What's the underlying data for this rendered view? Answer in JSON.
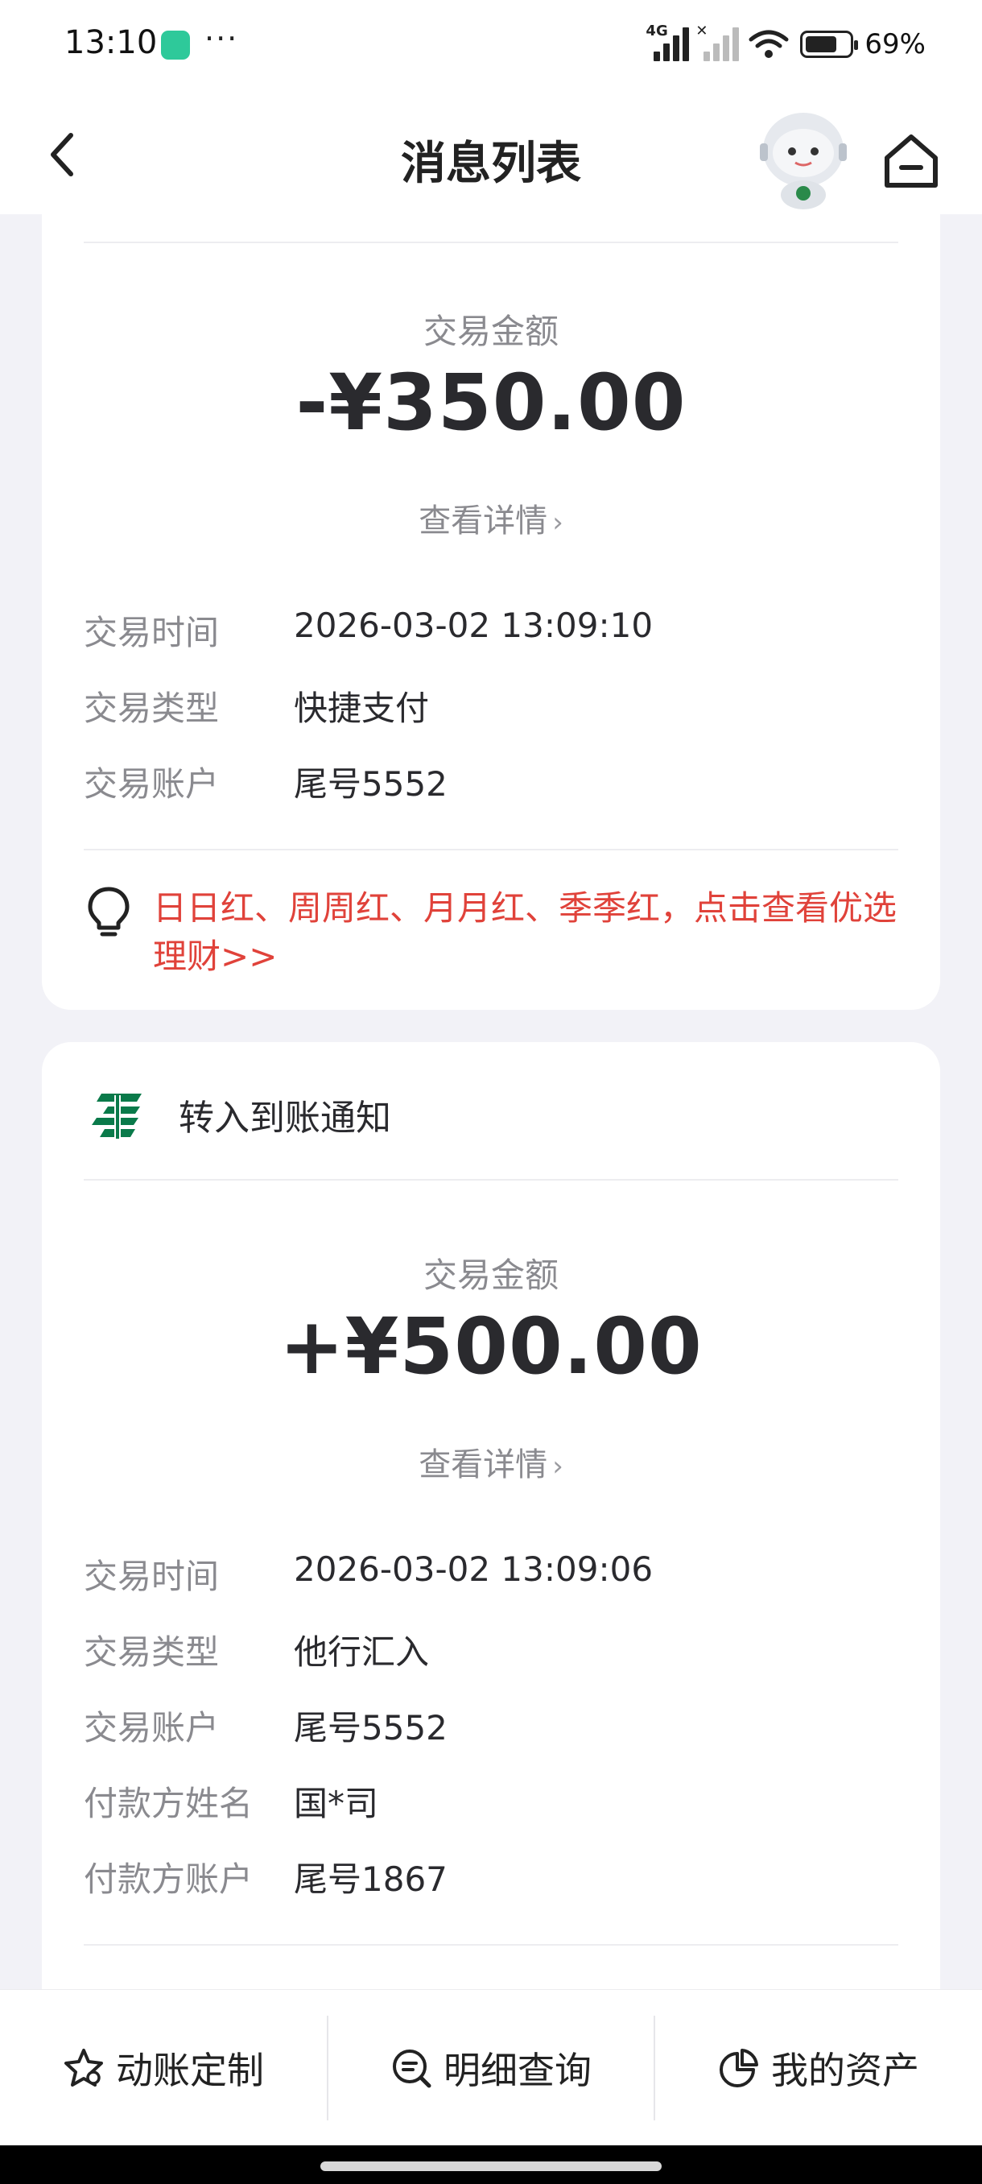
{
  "status_bar": {
    "time": "13:10",
    "more": "···",
    "network": "4G",
    "battery": "69%"
  },
  "header": {
    "title": "消息列表"
  },
  "card1": {
    "amount_label": "交易金额",
    "amount": "-¥350.00",
    "detail_link": "查看详情",
    "rows": [
      {
        "label": "交易时间",
        "value": "2026-03-02 13:09:10"
      },
      {
        "label": "交易类型",
        "value": "快捷支付"
      },
      {
        "label": "交易账户",
        "value": "尾号5552"
      }
    ],
    "tip": "日日红、周周红、月月红、季季红，点击查看优选理财>>"
  },
  "card2": {
    "title": "转入到账通知",
    "amount_label": "交易金额",
    "amount": "+¥500.00",
    "detail_link": "查看详情",
    "rows": [
      {
        "label": "交易时间",
        "value": "2026-03-02 13:09:06"
      },
      {
        "label": "交易类型",
        "value": "他行汇入"
      },
      {
        "label": "交易账户",
        "value": "尾号5552"
      },
      {
        "label": "付款方姓名",
        "value": "国*司"
      },
      {
        "label": "付款方账户",
        "value": "尾号1867"
      }
    ]
  },
  "tabbar": {
    "tabs": [
      {
        "label": "动账定制",
        "icon": "star-settings-icon"
      },
      {
        "label": "明细查询",
        "icon": "search-list-icon"
      },
      {
        "label": "我的资产",
        "icon": "pie-chart-icon"
      }
    ]
  },
  "colors": {
    "accent_green": "#0a7a4a",
    "tip_red": "#e0423a",
    "page_bg": "#f2f2f7"
  }
}
